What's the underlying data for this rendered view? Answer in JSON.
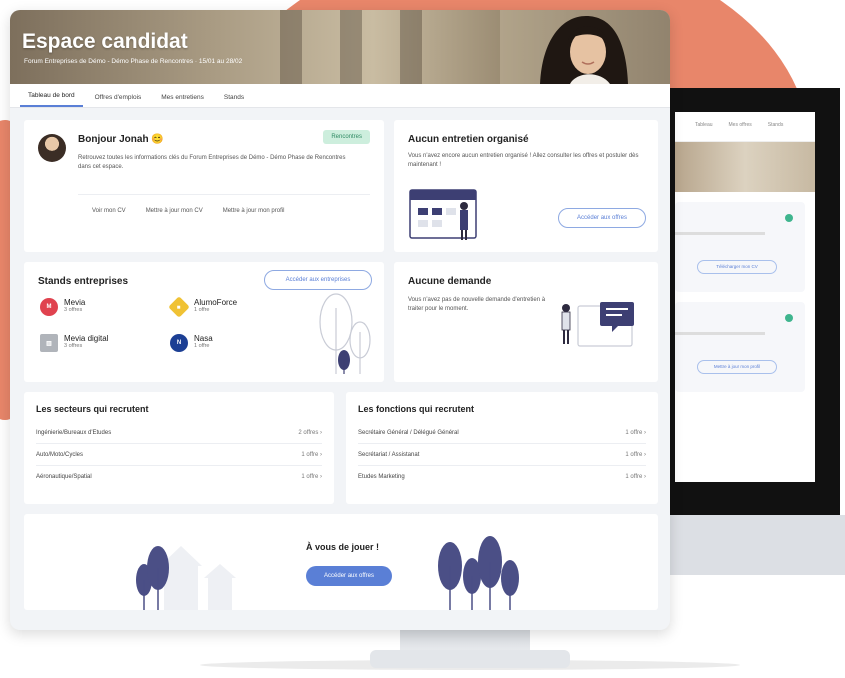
{
  "header": {
    "title": "Espace candidat",
    "subtitle": "Forum Entreprises de Démo - Démo Phase de Rencontres · 15/01 au 28/02"
  },
  "tabs": [
    {
      "label": "Tableau de bord",
      "active": true
    },
    {
      "label": "Offres d'emplois",
      "active": false
    },
    {
      "label": "Mes entretiens",
      "active": false
    },
    {
      "label": "Stands",
      "active": false
    }
  ],
  "welcome": {
    "greeting": "Bonjour Jonah 😊",
    "badge": "Rencontres",
    "text": "Retrouvez toutes les informations clés du Forum Entreprises de Démo - Démo Phase de Rencontres dans cet espace.",
    "links": [
      "Voir mon CV",
      "Mettre à jour mon CV",
      "Mettre à jour mon profil"
    ]
  },
  "interviews": {
    "title": "Aucun entretien organisé",
    "text": "Vous n'avez encore aucun entretien organisé ! Allez consulter les offres et postuler dès maintenant !",
    "button": "Accéder aux offres"
  },
  "stands": {
    "title": "Stands entreprises",
    "button": "Accéder aux entreprises",
    "items": [
      {
        "name": "Mevia",
        "offers": "3 offres",
        "color": "#e0424f",
        "glyph": "M"
      },
      {
        "name": "AlumoForce",
        "offers": "1 offre",
        "color": "#f0c234",
        "glyph": "◆"
      },
      {
        "name": "Mevia digital",
        "offers": "3 offres",
        "color": "#b0b4ba",
        "glyph": "▥"
      },
      {
        "name": "Nasa",
        "offers": "1 offre",
        "color": "#1c3f94",
        "glyph": "N"
      }
    ]
  },
  "requests": {
    "title": "Aucune demande",
    "text": "Vous n'avez pas de nouvelle demande d'entretien à traiter pour le moment."
  },
  "sectors": {
    "title": "Les secteurs qui recrutent",
    "rows": [
      {
        "label": "Ingénierie/Bureaux d'Etudes",
        "count": "2 offres ›"
      },
      {
        "label": "Auto/Moto/Cycles",
        "count": "1 offre ›"
      },
      {
        "label": "Aéronautique/Spatial",
        "count": "1 offre ›"
      }
    ]
  },
  "functions": {
    "title": "Les fonctions qui recrutent",
    "rows": [
      {
        "label": "Secrétaire Général / Délégué Général",
        "count": "1 offre ›"
      },
      {
        "label": "Secrétariat / Assistanat",
        "count": "1 offre ›"
      },
      {
        "label": "Etudes Marketing",
        "count": "1 offre ›"
      }
    ]
  },
  "play": {
    "title": "À vous de jouer !",
    "button": "Accéder aux offres"
  },
  "back_screen": {
    "nav": [
      "Tableau",
      "Mes offres",
      "Stands"
    ],
    "button_1": "Télécharger mon CV",
    "button_2": "Mettre à jour mon profil"
  },
  "colors": {
    "accent": "#5a7fd6",
    "coral": "#e8866a",
    "success": "#3fb58e"
  }
}
